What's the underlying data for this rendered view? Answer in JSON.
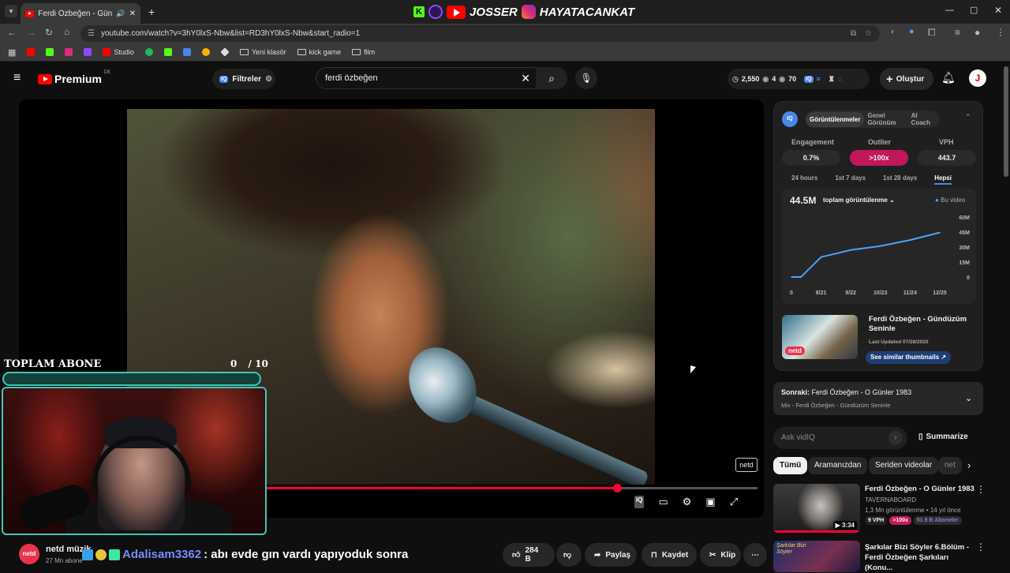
{
  "browser": {
    "tab_title": "Ferdi Özbeğen - Gündüzüm",
    "url": "youtube.com/watch?v=3hY0lxS-Nbw&list=RD3hY0lxS-Nbw&start_radio=1",
    "bookmarks": [
      "Studio",
      "Yeni klasör",
      "kick game",
      "film"
    ],
    "stream_banner": {
      "name1": "JOSSER",
      "name2": "HAYATACANKAT"
    }
  },
  "youtube": {
    "logo_text": "Premium",
    "region": "DE",
    "filters_label": "Filtreler",
    "search_value": "ferdi özbeğen",
    "stats": {
      "views": "2,550",
      "a": "4",
      "b": "70"
    },
    "create_label": "Oluştur",
    "avatar_letter": "J"
  },
  "player": {
    "progress_fraction": 0.81,
    "watermark": "netd"
  },
  "stream_overlay": {
    "title": "TOPLAM ABONE",
    "count": "0",
    "goal": "/ 10",
    "chat_user": "Adalisam3362",
    "chat_message": ": abı evde gın vardı yapıyoduk sonra"
  },
  "channel": {
    "name": "netd müzik",
    "subs": "27 Mn abone",
    "logo_text": "netd",
    "likes": "284 B",
    "share": "Paylaş",
    "save": "Kaydet",
    "clip": "Klip"
  },
  "vidiq": {
    "badge": "IQ",
    "tabs": [
      "Görüntülenmeler",
      "Genel Görünüm",
      "AI Coach"
    ],
    "metrics": [
      {
        "label": "Engagement",
        "value": "0.7%"
      },
      {
        "label": "Outlier",
        "value": ">100x"
      },
      {
        "label": "VPH",
        "value": "443.7"
      }
    ],
    "ranges": [
      "24 hours",
      "1st 7 days",
      "1st 28 days",
      "Hepsi"
    ],
    "total": "44.5M",
    "total_label": "toplam görüntülenme",
    "legend": "Bu video",
    "video_title": "Ferdi Özbeğen - Gündüzüm Seninle",
    "last_updated": "Last Updated 07/28/2020",
    "similar_btn": "See similar thumbnails",
    "thumb_logo": "netd"
  },
  "chart_data": {
    "type": "line",
    "x": [
      "0",
      "8/21",
      "9/22",
      "10/23",
      "11/24",
      "12/25"
    ],
    "y_ticks": [
      "60M",
      "45M",
      "30M",
      "15M",
      "0"
    ],
    "ylim": [
      0,
      60
    ],
    "series": [
      {
        "name": "Bu video",
        "values": [
          0,
          20,
          27,
          31,
          37,
          44.5
        ]
      }
    ]
  },
  "up_next": {
    "label": "Sonraki:",
    "title": "Ferdi Özbeğen - O Günler 1983",
    "mix": "Mix - Ferdi Özbeğen - Gündüzüm Seninle"
  },
  "ask": {
    "placeholder": "Ask vidIQ",
    "summarize": "Summarize"
  },
  "chips": [
    "Tümü",
    "Aramanızdan",
    "Seriden videolar",
    "net"
  ],
  "recommendations": [
    {
      "title": "Ferdi Özbeğen - O Günler 1983",
      "channel": "TAVERNABOARD",
      "meta": "1,3 Mn görüntülenme • 14 yıl önce",
      "vph": "9 VPH",
      "outlier": ">100x",
      "subs": "51.9 B Aboneler",
      "duration": "3:34"
    },
    {
      "title": "Şarkılar Bizi Söyler 6.Bölüm - Ferdi Özbeğen Şarkıları (Konu...",
      "thumb_text": "Şarkılar Bizi Söyler"
    }
  ]
}
